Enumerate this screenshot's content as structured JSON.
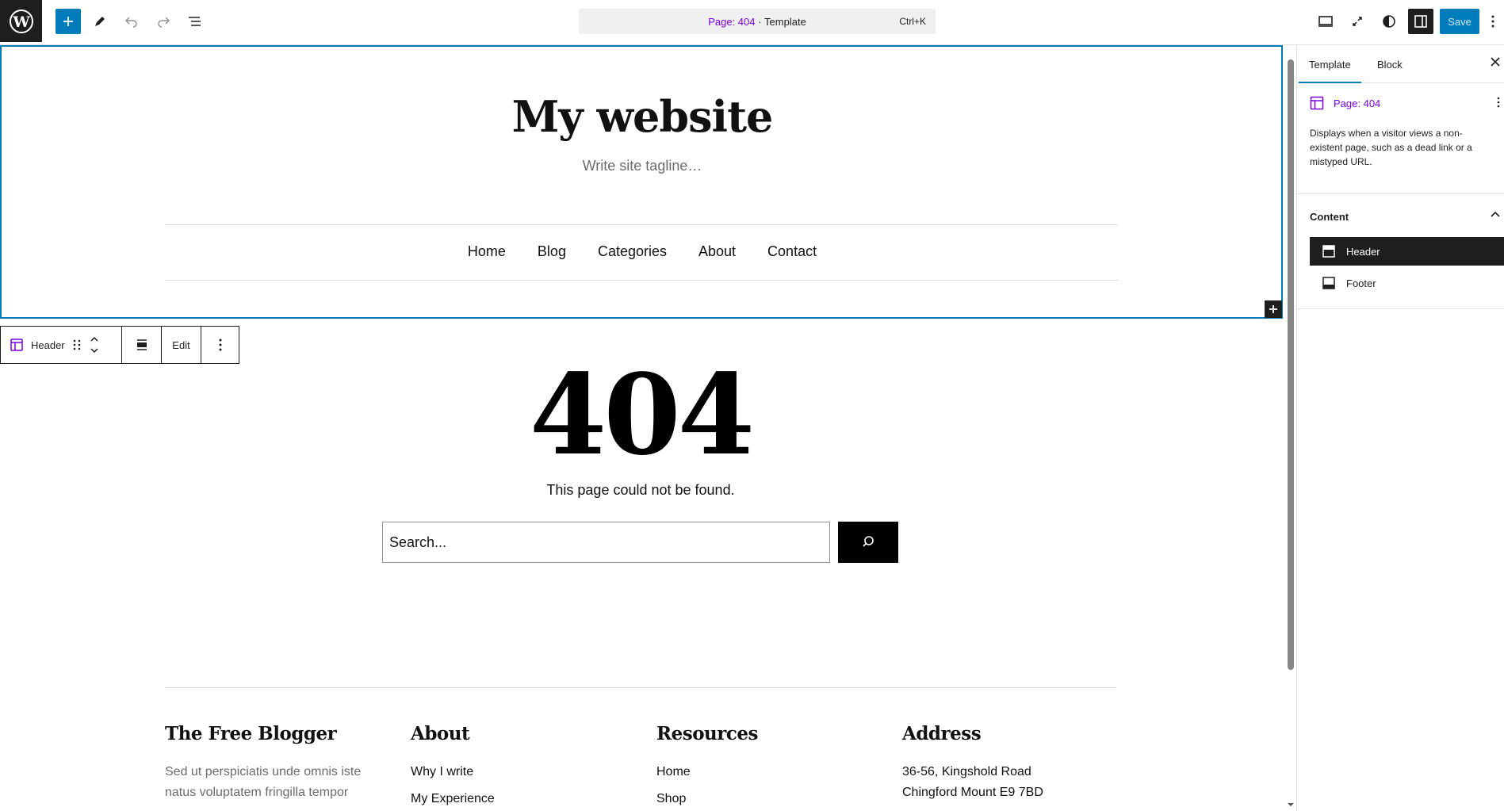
{
  "topbar": {
    "command_page": "Page: 404",
    "command_sep": " · ",
    "command_type": "Template",
    "shortcut": "Ctrl+K",
    "save_label": "Save"
  },
  "site": {
    "title": "My website",
    "tagline": "Write site tagline…",
    "nav": [
      "Home",
      "Blog",
      "Categories",
      "About",
      "Contact"
    ]
  },
  "block_toolbar": {
    "block_name": "Header",
    "edit_label": "Edit"
  },
  "content": {
    "heading": "404",
    "message": "This page could not be found.",
    "search_placeholder": "Search..."
  },
  "footer": {
    "columns": [
      {
        "heading": "The Free Blogger",
        "items": [
          "Sed ut perspiciatis unde omnis iste",
          "natus voluptatem fringilla tempor"
        ]
      },
      {
        "heading": "About",
        "items": [
          "Why I write",
          "My Experience"
        ]
      },
      {
        "heading": "Resources",
        "items": [
          "Home",
          "Shop"
        ]
      },
      {
        "heading": "Address",
        "items": [
          "36-56, Kingshold Road",
          "Chingford Mount E9 7BD"
        ]
      }
    ]
  },
  "sidebar": {
    "tabs": [
      "Template",
      "Block"
    ],
    "template_title": "Page: 404",
    "template_desc": "Displays when a visitor views a non-existent page, such as a dead link or a mistyped URL.",
    "content_label": "Content",
    "parts": [
      "Header",
      "Footer"
    ]
  },
  "colors": {
    "accent": "#007cba",
    "template_purple": "#7a00df",
    "dark": "#1e1e1e"
  }
}
